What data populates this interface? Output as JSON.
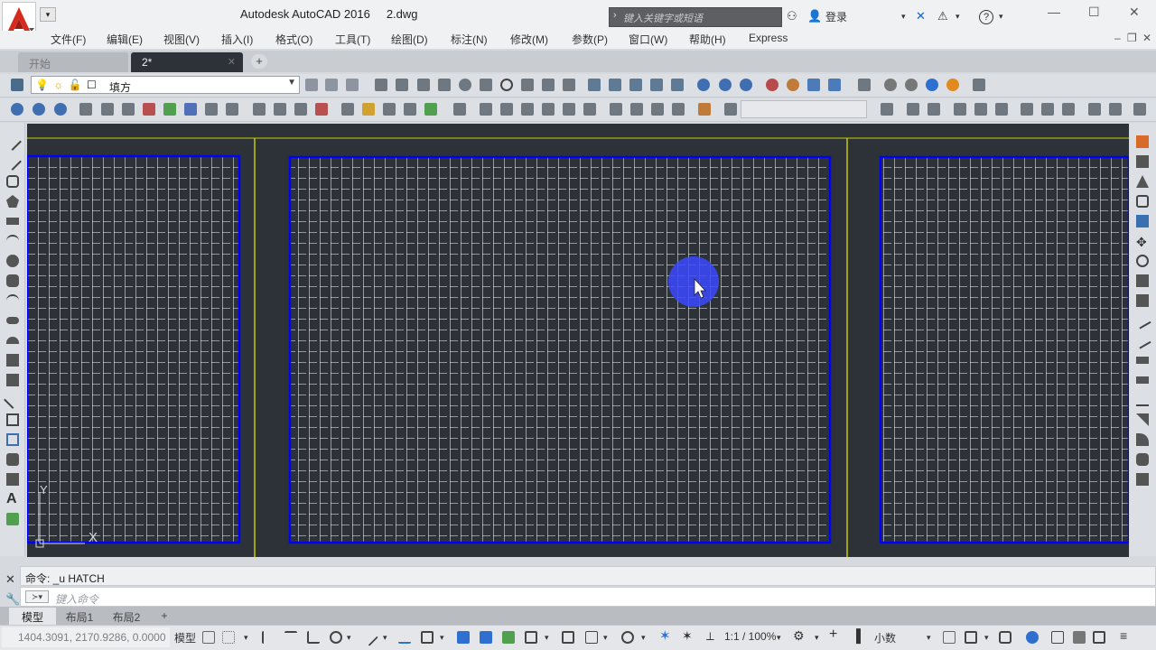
{
  "window": {
    "app_title": "Autodesk AutoCAD 2016",
    "file_name": "2.dwg",
    "search_placeholder": "键入关键字或短语",
    "login_label": "登录",
    "help_label": "?"
  },
  "menu": {
    "items": [
      "文件(F)",
      "编辑(E)",
      "视图(V)",
      "插入(I)",
      "格式(O)",
      "工具(T)",
      "绘图(D)",
      "标注(N)",
      "修改(M)",
      "参数(P)",
      "窗口(W)",
      "帮助(H)",
      "Express"
    ]
  },
  "file_tabs": [
    {
      "label": "开始",
      "active": false
    },
    {
      "label": "2*",
      "active": true
    }
  ],
  "add_tab_label": "+",
  "toolbar": {
    "layer_name": "填方"
  },
  "ucs": {
    "x_label": "X",
    "y_label": "Y"
  },
  "command": {
    "history": "命令: _u HATCH",
    "placeholder": "键入命令"
  },
  "layout_tabs": [
    {
      "label": "模型",
      "active": true
    },
    {
      "label": "布局1",
      "active": false
    },
    {
      "label": "布局2",
      "active": false
    }
  ],
  "layout_add_label": "+",
  "status": {
    "coordinates": "1404.3091, 2170.9286, 0.0000",
    "model_label": "模型",
    "scale": "1:1 / 100%",
    "units": "小数"
  },
  "colors": {
    "canvas_bg": "#2c3237",
    "boundary": "#0000ff",
    "grid": "#ffffff",
    "divider": "#ffff00",
    "highlight": "#3b49ff"
  }
}
